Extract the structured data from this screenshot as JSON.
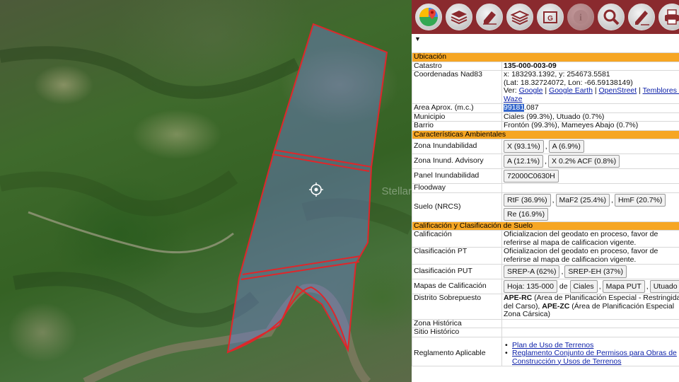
{
  "map": {
    "watermark": "Stellar"
  },
  "toolbar": {
    "tools": [
      {
        "name": "google-maps-tool",
        "icon": "google-maps-icon"
      },
      {
        "name": "layers-tool",
        "icon": "layers-icon"
      },
      {
        "name": "eraser-tool",
        "icon": "eraser-icon"
      },
      {
        "name": "basemap-tool",
        "icon": "stack-icon"
      },
      {
        "name": "gallery-tool",
        "icon": "gallery-icon"
      },
      {
        "name": "info-tool",
        "icon": "info-icon"
      },
      {
        "name": "search-tool",
        "icon": "magnifier-icon"
      },
      {
        "name": "draw-tool",
        "icon": "pencil-icon"
      },
      {
        "name": "print-tool",
        "icon": "printer-icon"
      }
    ]
  },
  "panel": {
    "caret": "▼",
    "ubicacion": {
      "header": "Ubicación",
      "catastro_label": "Catastro",
      "catastro_value": "135-000-003-09",
      "coords_label": "Coordenadas Nad83",
      "coords_xy": "x: 183293.1392, y: 254673.5581",
      "coords_latlon": "(Lat: 18.32724072, Lon: -66.59138149)",
      "ver_label": "Ver:",
      "ver_links": [
        "Google",
        "Google Earth",
        "OpenStreet",
        "Temblores USGS",
        "Waze"
      ],
      "area_label": "Area Aprox. (m.c.)",
      "area_highlight": "99181",
      "area_rest": ".087",
      "municipio_label": "Municipio",
      "municipio_value": "Ciales (99.3%), Utuado (0.7%)",
      "barrio_label": "Barrio",
      "barrio_value": "Frontón (99.3%), Mameyes Abajo (0.7%)"
    },
    "ambientales": {
      "header": "Características Ambientales",
      "inundabilidad_label": "Zona Inundabilidad",
      "inundabilidad_buttons": [
        "X (93.1%)",
        "A (6.9%)"
      ],
      "advisory_label": "Zona Inund. Advisory",
      "advisory_buttons": [
        "A (12.1%)",
        "X 0.2% ACF (0.8%)"
      ],
      "panel_label": "Panel Inundabilidad",
      "panel_buttons": [
        "72000C0630H"
      ],
      "floodway_label": "Floodway",
      "suelo_label": "Suelo (NRCS)",
      "suelo_buttons": [
        "RtF (36.9%)",
        "MaF2 (25.4%)",
        "HmF (20.7%)",
        "Re (16.9%)"
      ]
    },
    "calificacion": {
      "header": "Calificación y Clasificación de Suelo",
      "calificacion_label": "Calificación",
      "calificacion_value": "Oficializacion del geodato en proceso, favor de referirse al mapa de calificacion vigente.",
      "clasif_pt_label": "Clasificación PT",
      "clasif_pt_value": "Oficializacion del geodato en proceso, favor de referirse al mapa de calificacion vigente.",
      "clasif_put_label": "Clasificación PUT",
      "clasif_put_buttons": [
        "SREP-A (62%)",
        "SREP-EH (37%)"
      ],
      "mapas_label": "Mapas de Calificación",
      "mapas_buttons_a": [
        "Hoja: 135-000"
      ],
      "mapas_de": "de",
      "mapas_buttons_b": [
        "Ciales",
        "Mapa PUT",
        "Utuado"
      ],
      "distrito_label": "Distrito Sobrepuesto",
      "distrito_code1": "APE-RC",
      "distrito_text1": " (Área de Planificación Especial - Restringida del Carso), ",
      "distrito_code2": "APE-ZC",
      "distrito_text2": " (Área de Planificación Especial Zona Cársica)",
      "zona_historica_label": "Zona Histórica",
      "sitio_historico_label": "Sitio Histórico",
      "reglamento_label": "Reglamento Aplicable",
      "reglamento_links": [
        "Plan de Uso de Terrenos",
        "Reglamento Conjunto de Permisos para Obras de Construcción y Usos de Terrenos"
      ]
    }
  }
}
